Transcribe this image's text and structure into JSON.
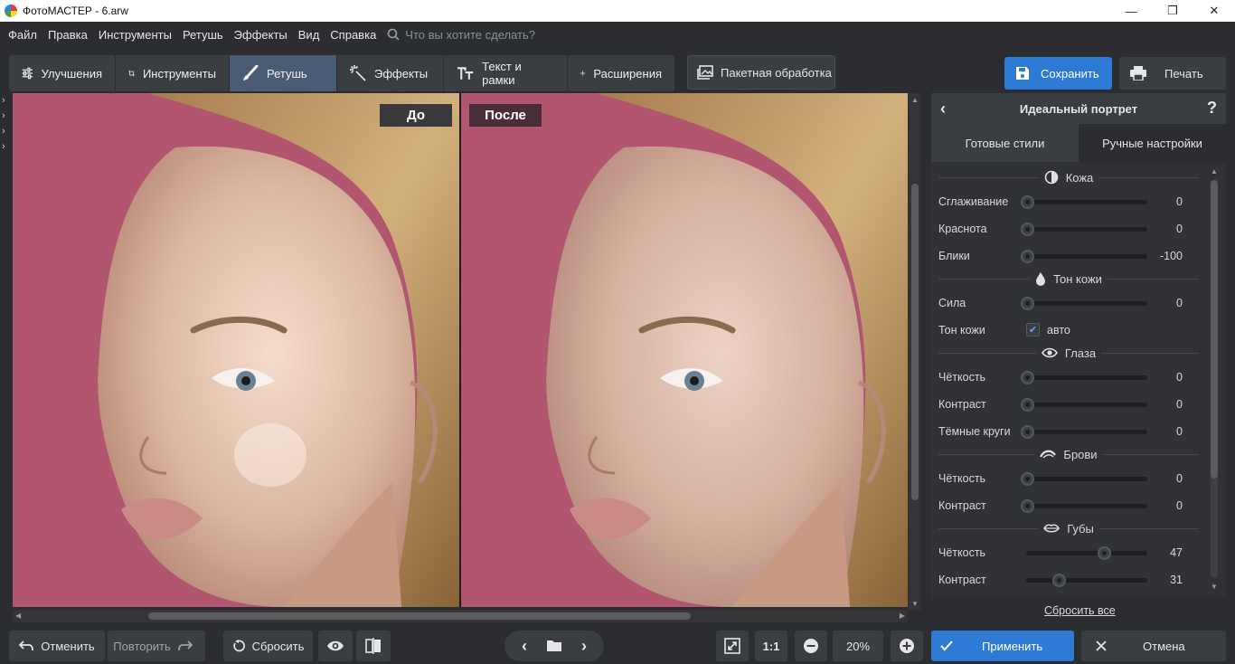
{
  "window": {
    "title": "ФотоМАСТЕР - 6.arw",
    "minimize": "—",
    "restore": "❐",
    "close": "✕"
  },
  "menu": [
    "Файл",
    "Правка",
    "Инструменты",
    "Ретушь",
    "Эффекты",
    "Вид",
    "Справка"
  ],
  "search": {
    "placeholder": "Что вы хотите сделать?"
  },
  "tabs": [
    {
      "label": "Улучшения",
      "icon": "sliders-icon"
    },
    {
      "label": "Инструменты",
      "icon": "crop-icon"
    },
    {
      "label": "Ретушь",
      "icon": "brush-icon",
      "active": true
    },
    {
      "label": "Эффекты",
      "icon": "magic-wand-icon"
    },
    {
      "label": "Текст и рамки",
      "icon": "text-icon"
    },
    {
      "label": "Расширения",
      "icon": "plus-icon"
    }
  ],
  "batch_label": "Пакетная обработка",
  "save_label": "Сохранить",
  "print_label": "Печать",
  "viewer": {
    "before_label": "До",
    "after_label": "После"
  },
  "panel": {
    "title": "Идеальный портрет",
    "help": "?",
    "tabs": {
      "presets": "Готовые стили",
      "manual": "Ручные настройки"
    },
    "sections": {
      "skin": {
        "title": "Кожа",
        "rows": [
          {
            "label": "Сглаживание",
            "value": "0",
            "level": 0
          },
          {
            "label": "Краснота",
            "value": "0",
            "level": 0
          },
          {
            "label": "Блики",
            "value": "-100",
            "level": 0
          }
        ]
      },
      "skin_tone": {
        "title": "Тон кожи",
        "rows": [
          {
            "label": "Сила",
            "value": "0",
            "level": 0
          }
        ],
        "toggle": {
          "label": "Тон кожи",
          "checkbox_label": "авто",
          "checked": true
        }
      },
      "eyes": {
        "title": "Глаза",
        "rows": [
          {
            "label": "Чёткость",
            "value": "0",
            "level": 0
          },
          {
            "label": "Контраст",
            "value": "0",
            "level": 0
          },
          {
            "label": "Тёмные круги",
            "value": "0",
            "level": 0
          }
        ]
      },
      "brows": {
        "title": "Брови",
        "rows": [
          {
            "label": "Чёткость",
            "value": "0",
            "level": 0
          },
          {
            "label": "Контраст",
            "value": "0",
            "level": 0
          }
        ]
      },
      "lips": {
        "title": "Губы",
        "rows": [
          {
            "label": "Чёткость",
            "value": "47",
            "level": 0.7
          },
          {
            "label": "Контраст",
            "value": "31",
            "level": 0.33
          }
        ]
      }
    },
    "reset_all": "Сбросить все"
  },
  "bottom": {
    "undo": "Отменить",
    "redo": "Повторить",
    "reset": "Сбросить",
    "zoom_one": "1:1",
    "zoom_value": "20%",
    "apply": "Применить",
    "cancel": "Отмена"
  },
  "colors": {
    "accent": "#2e7bd6",
    "active_tab": "#4a5c74",
    "background": "#2b2d31",
    "photo_bg": "#b1566e"
  }
}
